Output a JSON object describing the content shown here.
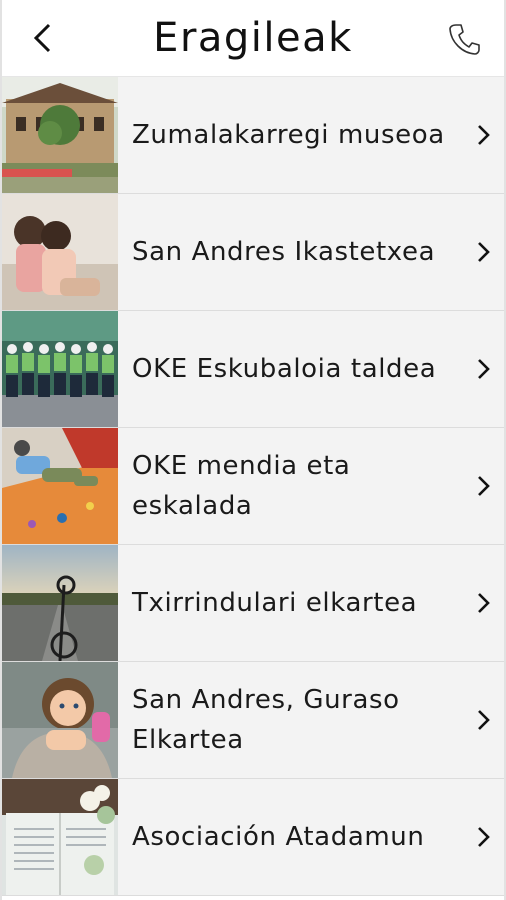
{
  "header": {
    "title": "Eragileak",
    "back_icon": "chevron-left-icon",
    "phone_icon": "phone-icon"
  },
  "items": [
    {
      "label": "Zumalakarregi museoa",
      "thumb": "museum-building-photo"
    },
    {
      "label": "San Andres Ikastetxea",
      "thumb": "children-photo"
    },
    {
      "label": "OKE Eskubaloia taldea",
      "thumb": "handball-team-photo"
    },
    {
      "label": "OKE mendia eta eskalada",
      "thumb": "climbing-wall-photo"
    },
    {
      "label": "Txirrindulari elkartea",
      "thumb": "road-bicycle-photo"
    },
    {
      "label": "San Andres, Guraso Elkartea",
      "thumb": "parent-child-hug-photo"
    },
    {
      "label": "Asociación Atadamun",
      "thumb": "book-flowers-photo"
    }
  ],
  "colors": {
    "row_bg": "#f3f3f3",
    "divider": "#dcdcdc",
    "text": "#1a1a1a"
  }
}
